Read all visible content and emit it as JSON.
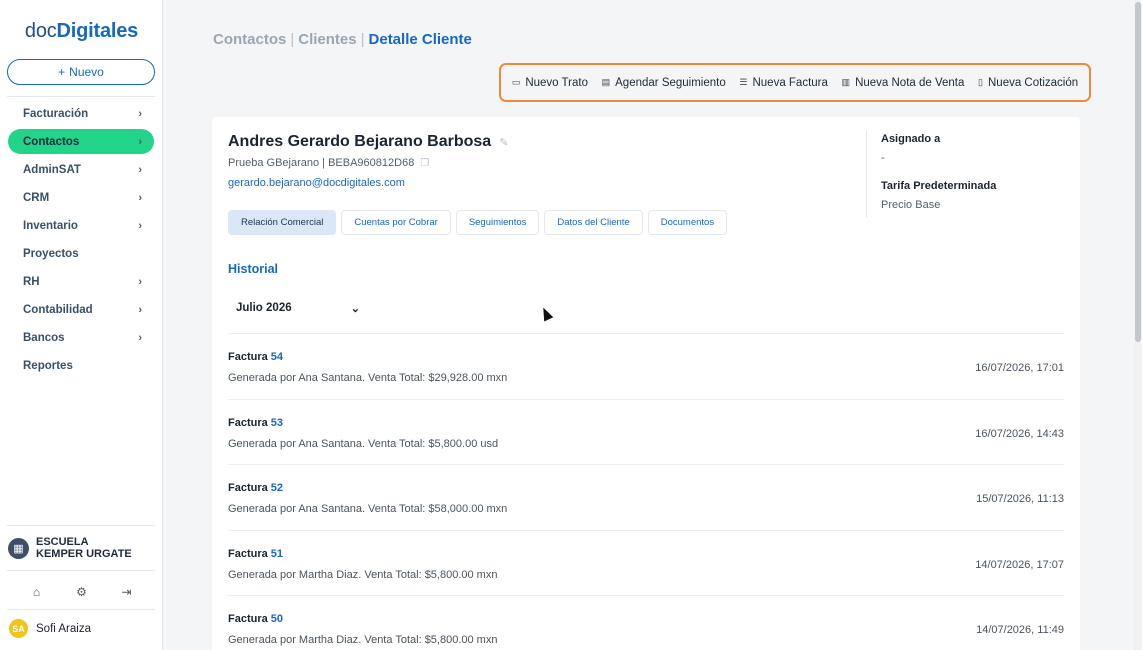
{
  "sidebar": {
    "logo_part1": "doc",
    "logo_part2": "Digitales",
    "new_button": "Nuevo",
    "nav": [
      {
        "label": "Facturación",
        "has_children": true
      },
      {
        "label": "Contactos",
        "has_children": true,
        "active": true
      },
      {
        "label": "AdminSAT",
        "has_children": true
      },
      {
        "label": "CRM",
        "has_children": true
      },
      {
        "label": "Inventario",
        "has_children": true
      },
      {
        "label": "Proyectos",
        "has_children": false
      },
      {
        "label": "RH",
        "has_children": true
      },
      {
        "label": "Contabilidad",
        "has_children": true
      },
      {
        "label": "Bancos",
        "has_children": true
      },
      {
        "label": "Reportes",
        "has_children": false
      }
    ],
    "org_name": "ESCUELA KEMPER URGATE",
    "user_initials": "SA",
    "user_name": "Sofi Araiza"
  },
  "breadcrumb": {
    "item1": "Contactos",
    "item2": "Clientes",
    "current": "Detalle Cliente"
  },
  "actions": {
    "nuevo_trato": "Nuevo Trato",
    "agendar_seguimiento": "Agendar Seguimiento",
    "nueva_factura": "Nueva Factura",
    "nueva_nota_venta": "Nueva Nota de Venta",
    "nueva_cotizacion": "Nueva Cotización"
  },
  "client": {
    "name": "Andres Gerardo Bejarano Barbosa",
    "subtitle": "Prueba GBejarano | BEBA960812D68",
    "email": "gerardo.bejarano@docdigitales.com",
    "assigned_label": "Asignado a",
    "assigned_value": "-",
    "tariff_label": "Tarifa Predeterminada",
    "tariff_value": "Precio Base"
  },
  "tabs": [
    {
      "label": "Relación Comercial",
      "active": true
    },
    {
      "label": "Cuentas por Cobrar"
    },
    {
      "label": "Seguimientos"
    },
    {
      "label": "Datos del Cliente"
    },
    {
      "label": "Documentos"
    }
  ],
  "history": {
    "title": "Historial",
    "month": "Julio 2026",
    "entries": [
      {
        "title": "Factura",
        "number": "54",
        "desc": "Generada por Ana Santana. Venta Total: $29,928.00 mxn",
        "date": "16/07/2026, 17:01"
      },
      {
        "title": "Factura",
        "number": "53",
        "desc": "Generada por Ana Santana. Venta Total: $5,800.00 usd",
        "date": "16/07/2026, 14:43"
      },
      {
        "title": "Factura",
        "number": "52",
        "desc": "Generada por Ana Santana. Venta Total: $58,000.00 mxn",
        "date": "15/07/2026, 11:13"
      },
      {
        "title": "Factura",
        "number": "51",
        "desc": "Generada por Martha Diaz. Venta Total: $5,800.00 mxn",
        "date": "14/07/2026, 17:07"
      },
      {
        "title": "Factura",
        "number": "50",
        "desc": "Generada por Martha Diaz. Venta Total: $5,800.00 mxn",
        "date": "14/07/2026, 11:49"
      }
    ]
  },
  "colors": {
    "accent": "#1668c1",
    "active_nav": "#22d38a",
    "highlight_border": "#ee8a3a"
  }
}
